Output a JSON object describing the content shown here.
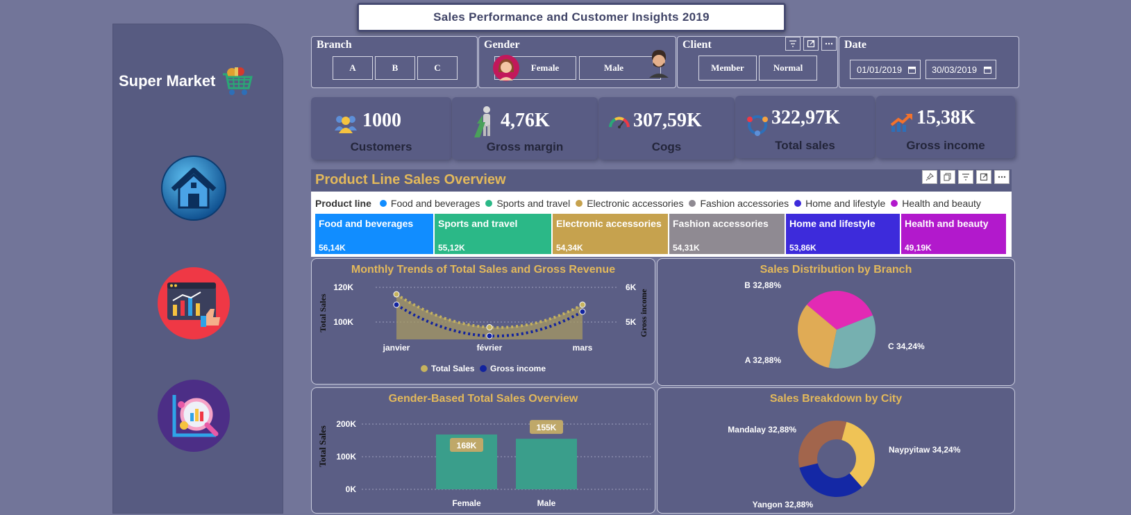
{
  "title": "Sales Performance and Customer Insights 2019",
  "brand": {
    "name": "Super Market"
  },
  "nav": [
    {
      "icon": "home-icon"
    },
    {
      "icon": "report-icon"
    },
    {
      "icon": "analysis-icon"
    }
  ],
  "slicers": {
    "branch": {
      "title": "Branch",
      "options": [
        "A",
        "B",
        "C"
      ]
    },
    "gender": {
      "title": "Gender",
      "options": [
        "Female",
        "Male"
      ]
    },
    "client": {
      "title": "Client",
      "options": [
        "Member",
        "Normal"
      ]
    },
    "date": {
      "title": "Date",
      "start": "01/01/2019",
      "end": "30/03/2019"
    }
  },
  "kpis": [
    {
      "value": "1000",
      "label": "Customers",
      "icon": "customers-icon"
    },
    {
      "value": "4,76K",
      "label": "Gross margin",
      "icon": "growth-person-icon"
    },
    {
      "value": "307,59K",
      "label": "Cogs",
      "icon": "gauge-icon"
    },
    {
      "value": "322,97K",
      "label": "Total sales",
      "icon": "sales-cycle-icon"
    },
    {
      "value": "15,38K",
      "label": "Gross income",
      "icon": "trend-up-icon"
    }
  ],
  "product_line": {
    "title": "Product Line Sales Overview",
    "legend_title": "Product line",
    "items": [
      {
        "name": "Food and beverages",
        "value": "56,14K",
        "color": "#118dff"
      },
      {
        "name": "Sports and travel",
        "value": "55,12K",
        "color": "#2bb887"
      },
      {
        "name": "Electronic accessories",
        "value": "54,34K",
        "color": "#c6a24e"
      },
      {
        "name": "Fashion accessories",
        "value": "54,31K",
        "color": "#8f8a92"
      },
      {
        "name": "Home and lifestyle",
        "value": "53,86K",
        "color": "#3d2bdb"
      },
      {
        "name": "Health and beauty",
        "value": "49,19K",
        "color": "#b219cc"
      }
    ]
  },
  "chart_data": [
    {
      "type": "line",
      "title": "Monthly Trends of Total Sales and Gross Revenue",
      "x": [
        "janvier",
        "février",
        "mars"
      ],
      "series": [
        {
          "name": "Total Sales",
          "values": [
            116000,
            97000,
            110000
          ],
          "axis": "left",
          "color": "#c6b35e"
        },
        {
          "name": "Gross income",
          "values": [
            5500,
            4600,
            5300
          ],
          "axis": "right",
          "color": "#12239e"
        }
      ],
      "ylabel": "Total Sales",
      "y2label": "Gross income",
      "ylim": [
        90000,
        120000
      ],
      "y2lim": [
        4500,
        6000
      ],
      "yticks": [
        "100K",
        "120K"
      ],
      "y2ticks": [
        "5K",
        "6K"
      ],
      "legend": "bottom"
    },
    {
      "type": "pie",
      "title": "Sales Distribution by Branch",
      "categories": [
        "B",
        "C",
        "A"
      ],
      "values": [
        32.88,
        34.24,
        32.88
      ],
      "labels": [
        "B 32,88%",
        "C 34,24%",
        "A 32,88%"
      ],
      "colors": [
        "#e22ab4",
        "#76b0b0",
        "#e0ab55"
      ]
    },
    {
      "type": "bar",
      "title": "Gender-Based Total Sales Overview",
      "categories": [
        "Female",
        "Male"
      ],
      "values": [
        168000,
        155000
      ],
      "data_labels": [
        "168K",
        "155K"
      ],
      "ylabel": "Total Sales",
      "ylim": [
        0,
        200000
      ],
      "yticks": [
        "0K",
        "100K",
        "200K"
      ],
      "color": "#3a9e8b"
    },
    {
      "type": "pie",
      "title": "Sales Breakdown by City",
      "categories": [
        "Naypyitaw",
        "Yangon",
        "Mandalay"
      ],
      "values": [
        34.24,
        32.88,
        32.88
      ],
      "labels": [
        "Naypyitaw 34,24%",
        "Yangon 32,88%",
        "Mandalay 32,88%"
      ],
      "colors": [
        "#efc356",
        "#1428a5",
        "#a2654c"
      ]
    }
  ]
}
